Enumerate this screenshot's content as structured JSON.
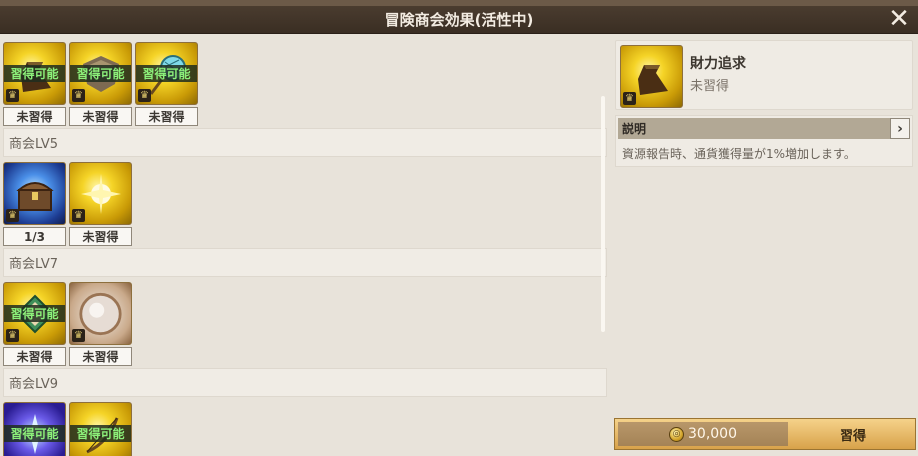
{
  "window": {
    "title": "冒険商会効果(活性中)"
  },
  "levels": [
    {
      "label": "",
      "skills": [
        {
          "icon": "bag-icon",
          "style": "gold",
          "badge": "習得可能",
          "status": "未習得"
        },
        {
          "icon": "shield-icon",
          "style": "gold",
          "badge": "習得可能",
          "status": "未習得"
        },
        {
          "icon": "net-icon",
          "style": "gold",
          "badge": "習得可能",
          "status": "未習得"
        }
      ]
    },
    {
      "label": "商会LV5",
      "skills": [
        {
          "icon": "treasure-chest-icon",
          "style": "blue",
          "badge": "",
          "status": "1/3"
        },
        {
          "icon": "sparkle-icon",
          "style": "gold",
          "badge": "",
          "status": "未習得"
        }
      ]
    },
    {
      "label": "商会LV7",
      "skills": [
        {
          "icon": "badge-icon",
          "style": "gold",
          "badge": "習得可能",
          "status": "未習得"
        },
        {
          "icon": "pearl-icon",
          "style": "gold",
          "badge": "",
          "status": "未習得"
        }
      ]
    },
    {
      "label": "商会LV9",
      "skills": [
        {
          "icon": "burst-icon",
          "style": "blue",
          "badge": "習得可能",
          "status": ""
        },
        {
          "icon": "bow-icon",
          "style": "gold",
          "badge": "習得可能",
          "status": ""
        }
      ]
    }
  ],
  "detail": {
    "icon": "bag-icon",
    "name": "財力追求",
    "status": "未習得",
    "section_label": "説明",
    "description": "資源報告時、通貨獲得量が1%増加します。"
  },
  "purchase": {
    "cost": "30,000",
    "button_label": "習得"
  },
  "colors": {
    "title_bar": "#3a2e23",
    "badge_text": "#8cf07a",
    "button": "#d8a24a"
  }
}
